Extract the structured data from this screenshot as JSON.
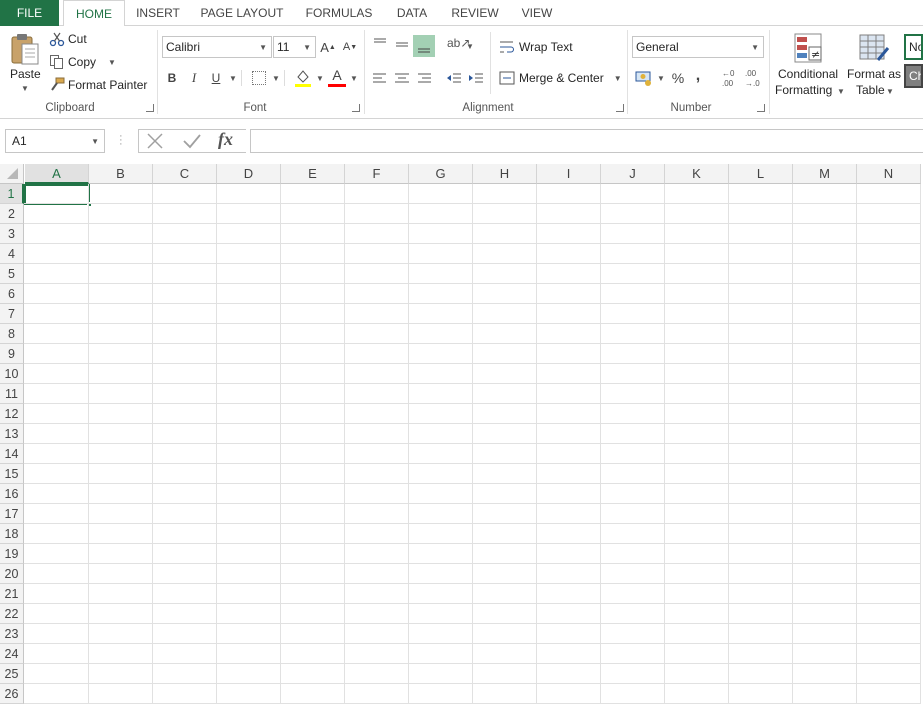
{
  "tabs": [
    "FILE",
    "HOME",
    "INSERT",
    "PAGE LAYOUT",
    "FORMULAS",
    "DATA",
    "REVIEW",
    "VIEW"
  ],
  "clipboard": {
    "paste": "Paste",
    "cut": "Cut",
    "copy": "Copy",
    "format_painter": "Format Painter",
    "label": "Clipboard"
  },
  "font": {
    "name": "Calibri",
    "size": "11",
    "label": "Font"
  },
  "alignment": {
    "wrap_text": "Wrap Text",
    "merge_center": "Merge & Center",
    "label": "Alignment"
  },
  "number": {
    "format": "General",
    "label": "Number"
  },
  "styles": {
    "conditional_line1": "Conditional",
    "conditional_line2": "Formatting",
    "format_as_line1": "Format as",
    "format_as_line2": "Table",
    "cell_style_1": "No",
    "cell_style_2": "Ch"
  },
  "formula_bar": {
    "name_box": "A1",
    "fx": "fx",
    "value": ""
  },
  "grid": {
    "columns": [
      "A",
      "B",
      "C",
      "D",
      "E",
      "F",
      "G",
      "H",
      "I",
      "J",
      "K",
      "L",
      "M",
      "N"
    ],
    "rows": [
      "1",
      "2",
      "3",
      "4",
      "5",
      "6",
      "7",
      "8",
      "9",
      "10",
      "11",
      "12",
      "13",
      "14",
      "15",
      "16",
      "17",
      "18",
      "19",
      "20",
      "21",
      "22",
      "23",
      "24",
      "25",
      "26"
    ],
    "selected_cell": "A1"
  },
  "colors": {
    "accent": "#217346",
    "font_color_bar": "#ff0000",
    "highlight_bar": "#ffff00"
  }
}
